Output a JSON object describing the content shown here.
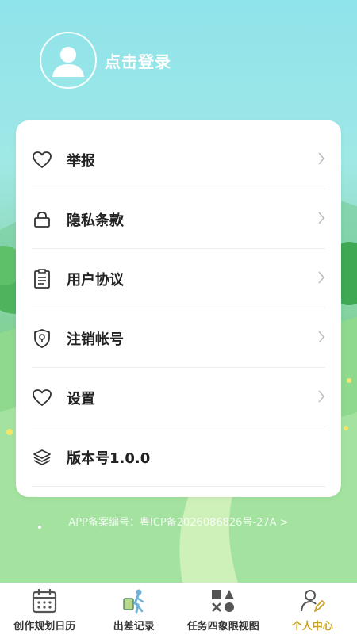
{
  "header": {
    "login_text": "点击登录"
  },
  "menu": [
    {
      "label": "举报",
      "icon": "heart-icon",
      "has_chevron": true
    },
    {
      "label": "隐私条款",
      "icon": "lock-icon",
      "has_chevron": true
    },
    {
      "label": "用户协议",
      "icon": "clipboard-icon",
      "has_chevron": true
    },
    {
      "label": "注销帐号",
      "icon": "shield-key-icon",
      "has_chevron": true
    },
    {
      "label": "设置",
      "icon": "heart-icon",
      "has_chevron": true
    },
    {
      "label": "版本号1.0.0",
      "icon": "layers-icon",
      "has_chevron": false
    }
  ],
  "footer": {
    "icp_text": "APP备案编号：粤ICP备2026086826号-27A >"
  },
  "tabbar": {
    "tabs": [
      {
        "label": "创作规划日历",
        "icon": "calendar-icon",
        "active": false
      },
      {
        "label": "出差记录",
        "icon": "traveler-icon",
        "active": false
      },
      {
        "label": "任务四象限视图",
        "icon": "shapes-icon",
        "active": false
      },
      {
        "label": "个人中心",
        "icon": "user-edit-icon",
        "active": true
      }
    ]
  },
  "colors": {
    "active_tab": "#c9a227",
    "text": "#222222"
  }
}
